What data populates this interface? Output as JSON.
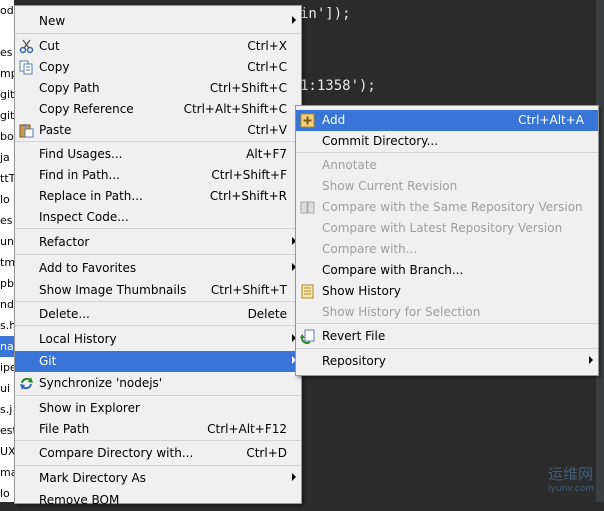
{
  "tree": [
    "odejs",
    "",
    "es",
    "mp",
    "git",
    "git",
    "bo",
    "ja",
    "ttT",
    "lo",
    "es",
    "un",
    "tm",
    "pb",
    "nd",
    "s.h",
    "na",
    "ipe",
    "ui",
    "s.j",
    "est",
    "UX",
    "ma",
    "lo"
  ],
  "editor": {
    "line1": "in']);",
    "line2": "1:1358');"
  },
  "watermark": {
    "title": "运维网",
    "subtitle": "iyunv.com"
  },
  "main_menu": [
    {
      "label": "New",
      "shortcut": "",
      "arrow": true,
      "icon": ""
    },
    {
      "label": "Cut",
      "shortcut": "Ctrl+X",
      "icon": "scissors-icon"
    },
    {
      "label": "Copy",
      "shortcut": "Ctrl+C",
      "icon": "copy-icon"
    },
    {
      "label": "Copy Path",
      "shortcut": "Ctrl+Shift+C",
      "icon": ""
    },
    {
      "label": "Copy Reference",
      "shortcut": "Ctrl+Alt+Shift+C",
      "icon": ""
    },
    {
      "label": "Paste",
      "shortcut": "Ctrl+V",
      "icon": "paste-icon"
    },
    {
      "label": "Find Usages...",
      "shortcut": "Alt+F7",
      "icon": ""
    },
    {
      "label": "Find in Path...",
      "shortcut": "Ctrl+Shift+F",
      "icon": ""
    },
    {
      "label": "Replace in Path...",
      "shortcut": "Ctrl+Shift+R",
      "icon": ""
    },
    {
      "label": "Inspect Code...",
      "shortcut": "",
      "icon": ""
    },
    {
      "label": "Refactor",
      "shortcut": "",
      "arrow": true,
      "icon": ""
    },
    {
      "label": "Add to Favorites",
      "shortcut": "",
      "arrow": true,
      "icon": ""
    },
    {
      "label": "Show Image Thumbnails",
      "shortcut": "Ctrl+Shift+T",
      "icon": ""
    },
    {
      "label": "Delete...",
      "shortcut": "Delete",
      "icon": ""
    },
    {
      "label": "Local History",
      "shortcut": "",
      "arrow": true,
      "icon": ""
    },
    {
      "label": "Git",
      "shortcut": "",
      "arrow": true,
      "icon": "",
      "highlighted": true
    },
    {
      "label": "Synchronize 'nodejs'",
      "shortcut": "",
      "icon": "sync-icon"
    },
    {
      "label": "Show in Explorer",
      "shortcut": "",
      "icon": ""
    },
    {
      "label": "File Path",
      "shortcut": "Ctrl+Alt+F12",
      "icon": ""
    },
    {
      "label": "Compare Directory with...",
      "shortcut": "Ctrl+D",
      "icon": ""
    },
    {
      "label": "Mark Directory As",
      "shortcut": "",
      "arrow": true,
      "icon": ""
    },
    {
      "label": "Remove BOM",
      "shortcut": "",
      "icon": ""
    }
  ],
  "git_menu": [
    {
      "label": "Add",
      "shortcut": "Ctrl+Alt+A",
      "icon": "plus-icon",
      "highlighted": true
    },
    {
      "label": "Commit Directory...",
      "shortcut": "",
      "icon": ""
    },
    {
      "label": "Annotate",
      "shortcut": "",
      "icon": "",
      "disabled": true
    },
    {
      "label": "Show Current Revision",
      "shortcut": "",
      "icon": "",
      "disabled": true
    },
    {
      "label": "Compare with the Same Repository Version",
      "shortcut": "",
      "icon": "compare-icon",
      "disabled": true
    },
    {
      "label": "Compare with Latest Repository Version",
      "shortcut": "",
      "icon": "",
      "disabled": true
    },
    {
      "label": "Compare with...",
      "shortcut": "",
      "icon": "",
      "disabled": true
    },
    {
      "label": "Compare with Branch...",
      "shortcut": "",
      "icon": ""
    },
    {
      "label": "Show History",
      "shortcut": "",
      "icon": "history-icon"
    },
    {
      "label": "Show History for Selection",
      "shortcut": "",
      "icon": "",
      "disabled": true
    },
    {
      "label": "Revert File",
      "shortcut": "",
      "icon": "revert-icon"
    },
    {
      "label": "Repository",
      "shortcut": "",
      "arrow": true,
      "icon": ""
    }
  ],
  "colors": {
    "highlight": "#3875d7",
    "menu_bg": "#f0f0f0",
    "editor_bg": "#2b2b2b",
    "disabled": "#9e9e9e"
  }
}
